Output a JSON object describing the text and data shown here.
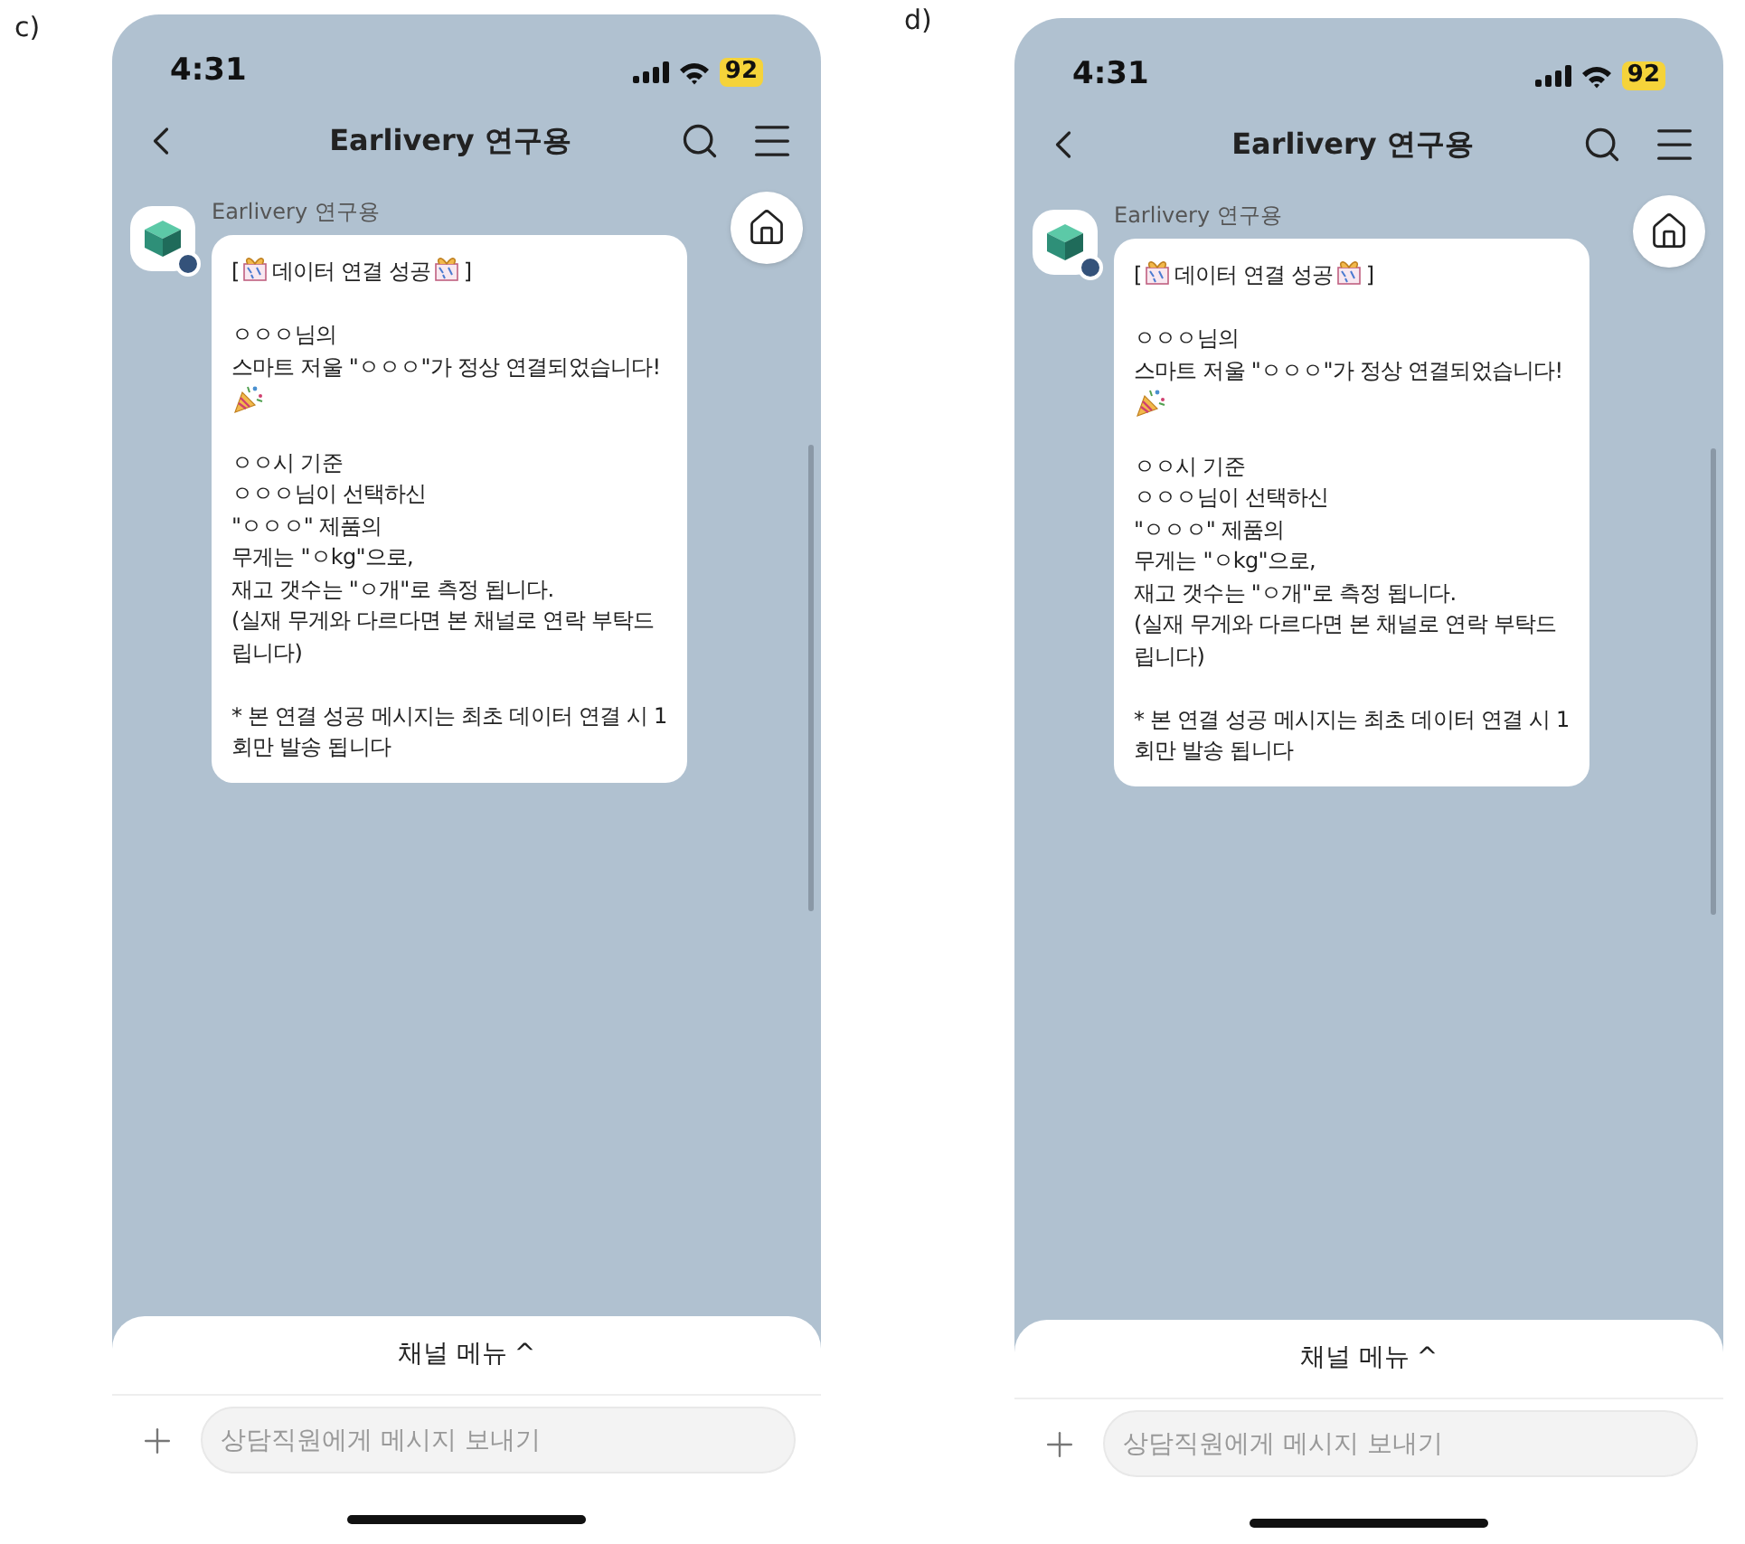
{
  "screens": [
    {
      "label": "c)",
      "status_bar": {
        "time": "4:31",
        "battery": "92"
      },
      "header": {
        "title": "Earlivery 연구용"
      },
      "message": {
        "sender": "Earlivery 연구용",
        "paragraphs": [
          [
            [
              {
                "kind": "text",
                "text": "["
              },
              {
                "kind": "gift"
              },
              {
                "kind": "text",
                "text": "데이터 연결 성공"
              },
              {
                "kind": "gift"
              },
              {
                "kind": "text",
                "text": "]"
              }
            ]
          ],
          [
            [
              {
                "kind": "text",
                "text": "ㅇㅇㅇ님의"
              }
            ],
            [
              {
                "kind": "text",
                "text": "스마트 저울 \"ㅇㅇㅇ\"가 정상 연결되었습니다!"
              }
            ],
            [
              {
                "kind": "party"
              }
            ]
          ],
          [
            [
              {
                "kind": "text",
                "text": "ㅇㅇ시 기준"
              }
            ],
            [
              {
                "kind": "text",
                "text": "ㅇㅇㅇ님이 선택하신"
              }
            ],
            [
              {
                "kind": "text",
                "text": "\"ㅇㅇㅇ\" 제품의"
              }
            ],
            [
              {
                "kind": "text",
                "text": "무게는 \"ㅇkg\"으로,"
              }
            ],
            [
              {
                "kind": "text",
                "text": "재고 갯수는 \"ㅇ개\"로 측정 됩니다."
              }
            ],
            [
              {
                "kind": "text",
                "text": "(실재 무게와 다르다면 본 채널로 연락 부탁드"
              }
            ],
            [
              {
                "kind": "text",
                "text": "립니다)"
              }
            ]
          ],
          [
            [
              {
                "kind": "text",
                "text": "* 본 연결 성공 메시지는 최초 데이터 연결 시 1"
              }
            ],
            [
              {
                "kind": "text",
                "text": "회만 발송 됩니다"
              }
            ]
          ]
        ]
      },
      "channel_menu": {
        "label": "채널 메뉴",
        "caret": "^"
      },
      "input": {
        "placeholder": "상담직원에게 메시지 보내기"
      }
    },
    {
      "label": "d)",
      "status_bar": {
        "time": "4:31",
        "battery": "92"
      },
      "header": {
        "title": "Earlivery 연구용"
      },
      "message": {
        "sender": "Earlivery 연구용",
        "paragraphs": [
          [
            [
              {
                "kind": "text",
                "text": "["
              },
              {
                "kind": "gift"
              },
              {
                "kind": "text",
                "text": "데이터 연결 성공"
              },
              {
                "kind": "gift"
              },
              {
                "kind": "text",
                "text": "]"
              }
            ]
          ],
          [
            [
              {
                "kind": "text",
                "text": "ㅇㅇㅇ님의"
              }
            ],
            [
              {
                "kind": "text",
                "text": "스마트 저울 \"ㅇㅇㅇ\"가 정상 연결되었습니다!"
              }
            ],
            [
              {
                "kind": "party"
              }
            ]
          ],
          [
            [
              {
                "kind": "text",
                "text": "ㅇㅇ시 기준"
              }
            ],
            [
              {
                "kind": "text",
                "text": "ㅇㅇㅇ님이 선택하신"
              }
            ],
            [
              {
                "kind": "text",
                "text": "\"ㅇㅇㅇ\" 제품의"
              }
            ],
            [
              {
                "kind": "text",
                "text": "무게는 \"ㅇkg\"으로,"
              }
            ],
            [
              {
                "kind": "text",
                "text": "재고 갯수는 \"ㅇ개\"로 측정 됩니다."
              }
            ],
            [
              {
                "kind": "text",
                "text": "(실재 무게와 다르다면 본 채널로 연락 부탁드"
              }
            ],
            [
              {
                "kind": "text",
                "text": "립니다)"
              }
            ]
          ],
          [
            [
              {
                "kind": "text",
                "text": "* 본 연결 성공 메시지는 최초 데이터 연결 시 1"
              }
            ],
            [
              {
                "kind": "text",
                "text": "회만 발송 됩니다"
              }
            ]
          ]
        ]
      },
      "channel_menu": {
        "label": "채널 메뉴",
        "caret": "^"
      },
      "input": {
        "placeholder": "상담직원에게 메시지 보내기"
      }
    }
  ]
}
